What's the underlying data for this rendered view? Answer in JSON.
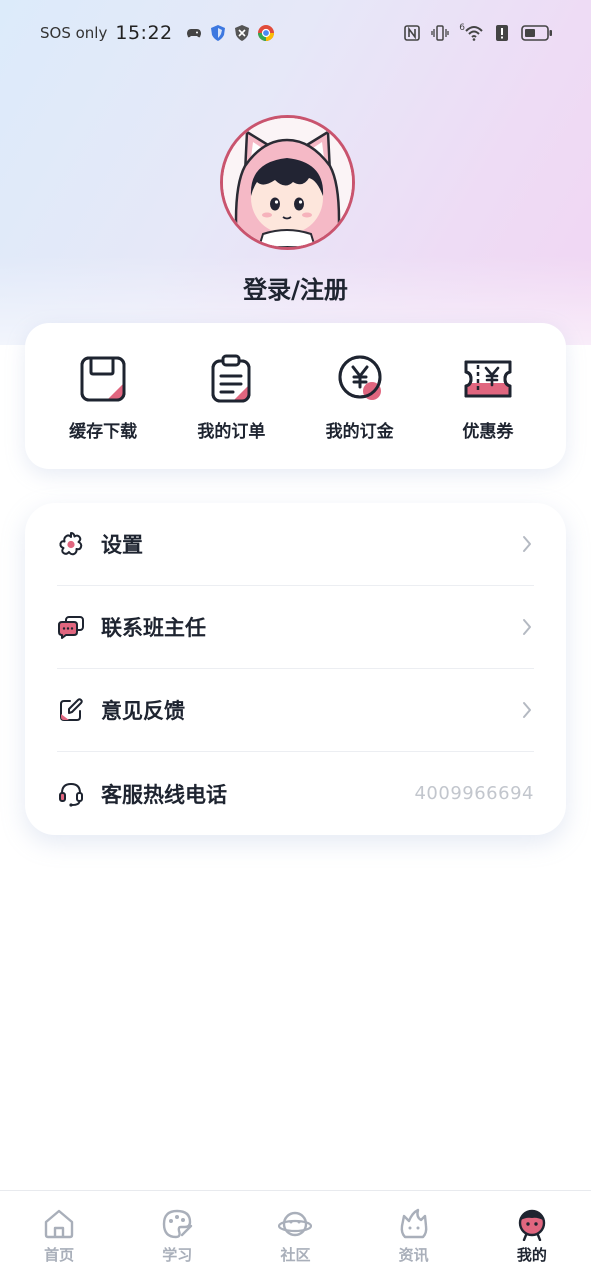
{
  "status_bar": {
    "carrier": "SOS only",
    "time": "15:22",
    "network": "6"
  },
  "profile": {
    "login_label": "登录/注册"
  },
  "quick_actions": [
    {
      "label": "缓存下载",
      "icon": "floppy-disk-icon"
    },
    {
      "label": "我的订单",
      "icon": "clipboard-icon"
    },
    {
      "label": "我的订金",
      "icon": "yen-coin-icon"
    },
    {
      "label": "优惠券",
      "icon": "yen-ticket-icon"
    }
  ],
  "menu": {
    "settings": {
      "label": "设置",
      "icon": "gear-flower-icon"
    },
    "contact": {
      "label": "联系班主任",
      "icon": "chat-bubbles-icon"
    },
    "feedback": {
      "label": "意见反馈",
      "icon": "edit-icon"
    },
    "hotline": {
      "label": "客服热线电话",
      "icon": "headset-icon",
      "value": "4009966694"
    }
  },
  "bottom_nav": [
    {
      "label": "首页",
      "icon": "home-icon",
      "active": false
    },
    {
      "label": "学习",
      "icon": "palette-icon",
      "active": false
    },
    {
      "label": "社区",
      "icon": "planet-icon",
      "active": false
    },
    {
      "label": "资讯",
      "icon": "flame-cat-icon",
      "active": false
    },
    {
      "label": "我的",
      "icon": "user-face-icon",
      "active": true
    }
  ],
  "colors": {
    "accent_pink": "#e0667f",
    "dark_text": "#1e2430",
    "inactive": "#a9afba"
  }
}
